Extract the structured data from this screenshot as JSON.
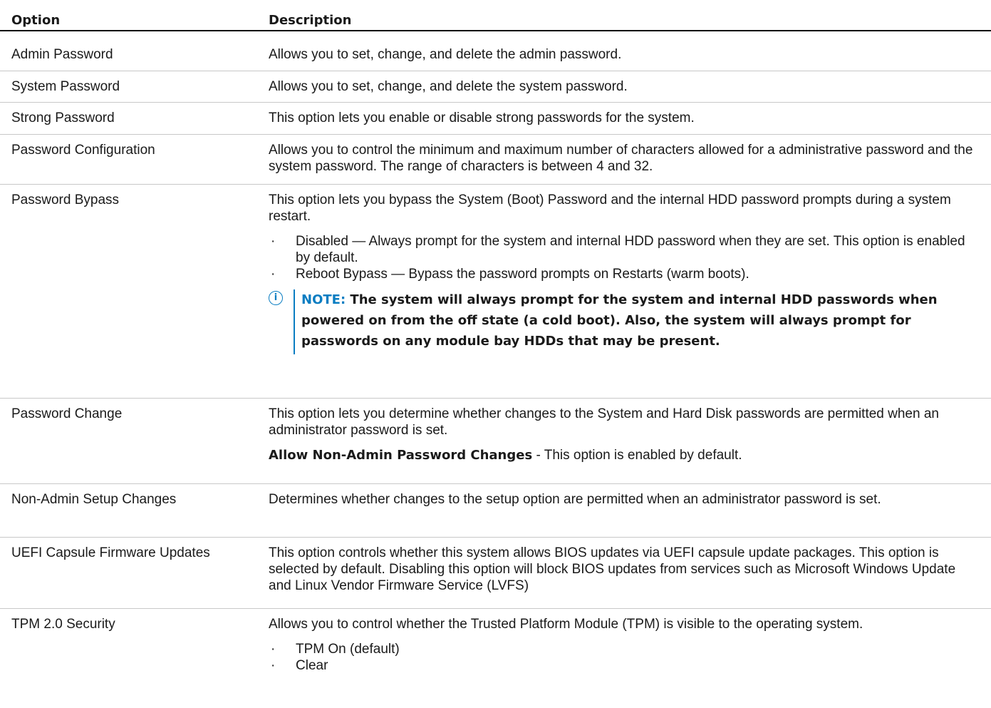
{
  "header": {
    "option": "Option",
    "description": "Description"
  },
  "rows": [
    {
      "option": "Admin Password",
      "desc": "Allows you to set, change, and delete the admin password."
    },
    {
      "option": "System Password",
      "desc": "Allows you to set, change, and delete the system password."
    },
    {
      "option": "Strong Password",
      "desc": "This option lets you enable or disable strong passwords for the system."
    },
    {
      "option": "Password Configuration",
      "desc": "Allows you to control the minimum and maximum number of characters allowed for a administrative password and the system password. The range of characters is between 4 and 32."
    },
    {
      "option": "Password Bypass",
      "desc": "This option lets you bypass the System (Boot) Password and the internal HDD password prompts during a system restart.",
      "bullets": [
        "Disabled — Always prompt for the system and internal HDD password when they are set. This option is enabled by default.",
        "Reboot Bypass — Bypass the password prompts on Restarts (warm boots)."
      ],
      "note_label": "NOTE:",
      "note_text": "The system will always prompt for the system and internal HDD passwords when powered on from the off state (a cold boot). Also, the system will always prompt for passwords on any module bay HDDs that may be present."
    },
    {
      "option": "Password Change",
      "desc": "This option lets you determine whether changes to the System and Hard Disk passwords are permitted when an administrator password is set.",
      "extra_bold": "Allow Non-Admin Password Changes",
      "extra_rest": " - This option is enabled by default."
    },
    {
      "option": "Non-Admin Setup Changes",
      "desc": "Determines whether changes to the setup option are permitted when an administrator password is set."
    },
    {
      "option": "UEFI Capsule Firmware Updates",
      "desc": "This option controls whether this system allows BIOS updates via UEFI capsule update packages. This option is selected by default. Disabling this option will block BIOS updates from services such as Microsoft Windows Update and Linux Vendor Firmware Service (LVFS)"
    },
    {
      "option": "TPM 2.0 Security",
      "desc": "Allows you to control whether the Trusted Platform Module (TPM) is visible to the operating system.",
      "bullets": [
        "TPM On (default)",
        "Clear"
      ]
    }
  ]
}
